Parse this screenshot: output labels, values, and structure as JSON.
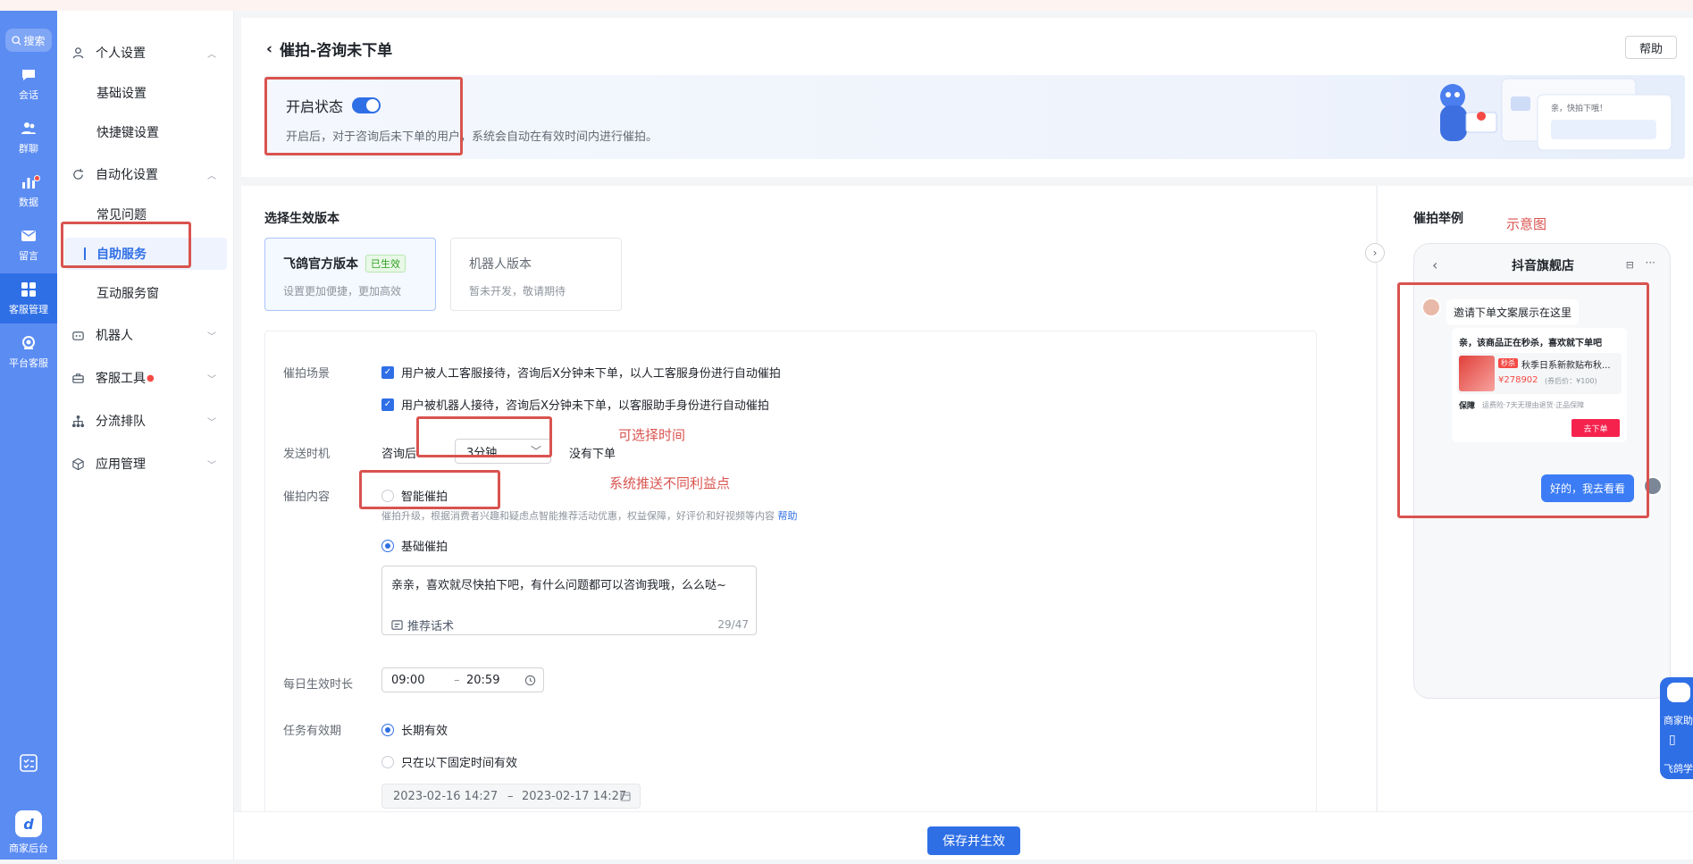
{
  "rail": {
    "search": "搜索",
    "items": [
      "会话",
      "群聊",
      "数据",
      "留言",
      "客服管理",
      "平台客服"
    ],
    "logo_label": "商家后台"
  },
  "sidebar": {
    "personal": "个人设置",
    "basic": "基础设置",
    "shortcut": "快捷键设置",
    "automation": "自动化设置",
    "faq": "常见问题",
    "self_service": "自助服务",
    "interactive": "互动服务窗",
    "robot": "机器人",
    "tools": "客服工具",
    "routing": "分流排队",
    "apps": "应用管理"
  },
  "header": {
    "title": "催拍-咨询未下单",
    "help": "帮助",
    "status_label": "开启状态",
    "status_desc": "开启后，对于咨询后未下单的用户，系统会自动在有效时间内进行催拍。",
    "status_on": true
  },
  "version": {
    "section_title": "选择生效版本",
    "official": {
      "title": "飞鸽官方版本",
      "tag": "已生效",
      "desc": "设置更加便捷，更加高效"
    },
    "robot": {
      "title": "机器人版本",
      "desc": "暂未开发，敬请期待"
    }
  },
  "form": {
    "scene_label": "催拍场景",
    "scene_1": "用户被人工客服接待，咨询后X分钟未下单，以人工客服身份进行自动催拍",
    "scene_2": "用户被机器人接待，咨询后X分钟未下单，以客服助手身份进行自动催拍",
    "timing_label": "发送时机",
    "timing_prefix": "咨询后",
    "timing_value": "3分钟",
    "timing_suffix": "没有下单",
    "content_label": "催拍内容",
    "smart": "智能催拍",
    "smart_desc": "催拍升级，根据消费者兴趣和疑虑点智能推荐活动优惠，权益保障，好评价和好视频等内容",
    "smart_help": "帮助",
    "basic": "基础催拍",
    "basic_text": "亲亲，喜欢就尽快拍下吧，有什么问题都可以咨询我哦，么么哒~",
    "recommend": "推荐话术",
    "count": "29/47",
    "daily_label": "每日生效时长",
    "time_start": "09:00",
    "time_sep": "–",
    "time_end": "20:59",
    "validity_label": "任务有效期",
    "long_term": "长期有效",
    "fixed": "只在以下固定时间有效",
    "date_start": "2023-02-16 14:27",
    "date_sep": "–",
    "date_end": "2023-02-17 14:27"
  },
  "preview": {
    "title": "催拍举例",
    "shop": "抖音旗舰店",
    "invite": "邀请下单文案展示在这里",
    "card_title": "亲，该商品正在秒杀，喜欢就下单吧",
    "flash_tag": "秒杀",
    "product": "秋季日系新款贴布秋...",
    "price": "¥278902",
    "orig_price": "(券后价：¥100)",
    "guarantee_tag": "保障",
    "guarantee": "运费险·7天无理由退货·正品保障",
    "order_btn": "去下单",
    "reply": "好的，我去看看"
  },
  "banner_illustration": {
    "chat_text": "亲，快拍下哦！"
  },
  "annotations": {
    "diagram": "示意图",
    "time": "可选择时间",
    "benefit": "系统推送不同利益点"
  },
  "footer": {
    "save": "保存并生效"
  },
  "float": {
    "a": "商家助",
    "b": "飞鸽学"
  },
  "colors": {
    "primary": "#2f6fe6",
    "rail": "#5b8cf2",
    "annotation": "#d9534f"
  }
}
